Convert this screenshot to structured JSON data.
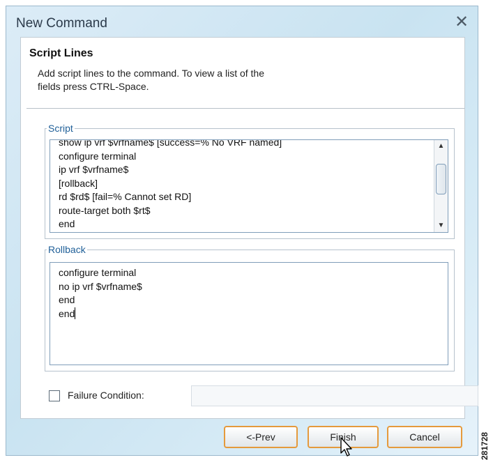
{
  "window": {
    "title": "New Command"
  },
  "panel": {
    "heading": "Script Lines",
    "description": "Add script lines to the command. To view a list of the\nfields press CTRL-Space."
  },
  "script": {
    "legend": "Script",
    "lines": [
      "show ip vrf $vrfname$ [success=% No VRF named]",
      "configure terminal",
      "ip vrf $vrfname$",
      "[rollback]",
      "rd $rd$ [fail=% Cannot set RD]",
      "route-target both $rt$",
      "end"
    ]
  },
  "rollback": {
    "legend": "Rollback",
    "lines": [
      "configure terminal",
      "no ip vrf $vrfname$",
      "end",
      "end"
    ]
  },
  "failure_condition": {
    "label": "Failure Condition:",
    "checked": false,
    "value": ""
  },
  "buttons": {
    "prev": "<-Prev",
    "finish": "Finish",
    "cancel": "Cancel"
  },
  "figure_id": "281728",
  "colors": {
    "button_border": "#e59a3c",
    "legend_text": "#1f5f98",
    "dialog_bg": "#c9e3f1"
  }
}
